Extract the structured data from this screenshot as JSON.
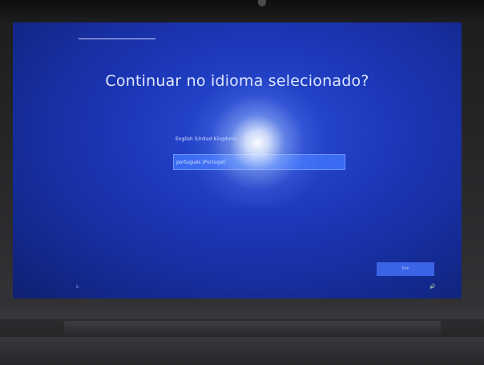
{
  "setup": {
    "title": "Continuar no idioma selecionado?",
    "languages": [
      {
        "label": "English (United Kingdom)",
        "selected": false
      },
      {
        "label": "português (Portugal)",
        "selected": true
      }
    ],
    "next_label": "Sim"
  },
  "icons": {
    "accessibility": "accessibility-icon",
    "volume": "volume-icon"
  },
  "colors": {
    "screen_blue": "#1c37b8",
    "selection_blue": "#3a6bf2",
    "button_blue": "#3b63e6"
  }
}
